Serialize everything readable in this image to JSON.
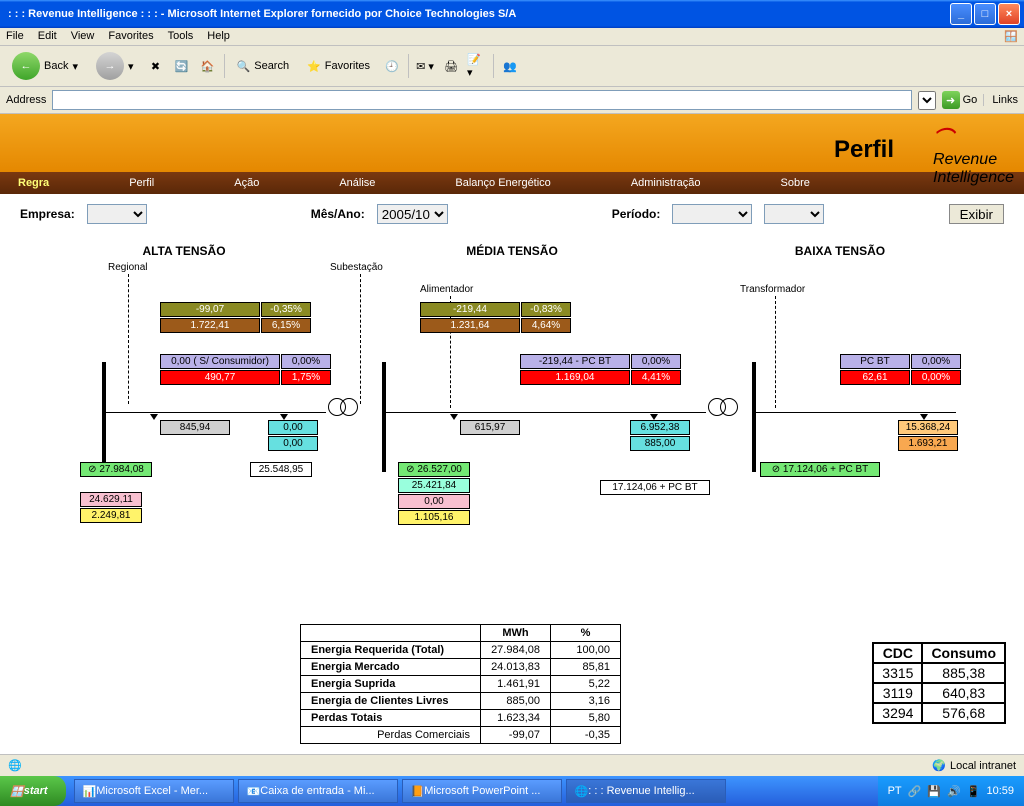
{
  "window": {
    "title": ": : : Revenue Intelligence : : : - Microsoft Internet Explorer fornecido por Choice Technologies S/A"
  },
  "menu": [
    "File",
    "Edit",
    "View",
    "Favorites",
    "Tools",
    "Help"
  ],
  "toolbar": {
    "back": "Back",
    "search": "Search",
    "favorites": "Favorites"
  },
  "addressbar": {
    "label": "Address",
    "go": "Go",
    "links": "Links"
  },
  "page": {
    "title": "Perfil",
    "brand_top": "Revenue",
    "brand_bot": "Intelligence"
  },
  "tabs": [
    "Regra",
    "Perfil",
    "Ação",
    "Análise",
    "Balanço Energético",
    "Administração",
    "Sobre"
  ],
  "filters": {
    "empresa": "Empresa:",
    "mesano": "Mês/Ano:",
    "mesano_val": "2005/10",
    "periodo": "Período:",
    "exibir": "Exibir"
  },
  "columns": [
    "ALTA TENSÃO",
    "MÉDIA TENSÃO",
    "BAIXA TENSÃO"
  ],
  "labels": {
    "regional": "Regional",
    "subestacao": "Subestação",
    "alimentador": "Alimentador",
    "transformador": "Transformador"
  },
  "alta": {
    "top_l": "-99,07",
    "top_r": "-0,35%",
    "mid_l": "1.722,41",
    "mid_r": "6,15%",
    "lav_l": "0,00 ( S/ Consumidor)",
    "lav_r": "0,00%",
    "red_l": "490,77",
    "red_r": "1,75%",
    "gray": "845,94",
    "cyan1": "0,00",
    "cyan2": "0,00",
    "green": "27.984,08",
    "white": "25.548,95",
    "pink": "24.629,11",
    "yellow": "2.249,81"
  },
  "media": {
    "top_l": "-219,44",
    "top_r": "-0,83%",
    "mid_l": "1.231,64",
    "mid_r": "4,64%",
    "lav_l": "-219,44 - PC BT",
    "lav_r": "0,00%",
    "red_l": "1.169,04",
    "red_r": "4,41%",
    "gray": "615,97",
    "cyan1": "6.952,38",
    "cyan2": "885,00",
    "green": "26.527,00",
    "aqua": "25.421,84",
    "pink": "0,00",
    "yellow": "1.105,16",
    "white": "17.124,06 + PC BT"
  },
  "baixa": {
    "lav_l": "PC BT",
    "lav_r": "0,00%",
    "red_l": "62,61",
    "red_r": "0,00%",
    "ltorange": "15.368,24",
    "orange": "1.693,21",
    "green": "17.124,06 + PC BT"
  },
  "summary": {
    "head_mwh": "MWh",
    "head_pct": "%",
    "rows": [
      {
        "label": "Energia Requerida (Total)",
        "mwh": "27.984,08",
        "pct": "100,00"
      },
      {
        "label": "Energia Mercado",
        "mwh": "24.013,83",
        "pct": "85,81"
      },
      {
        "label": "Energia Suprida",
        "mwh": "1.461,91",
        "pct": "5,22"
      },
      {
        "label": "Energia de Clientes Livres",
        "mwh": "885,00",
        "pct": "3,16"
      },
      {
        "label": "Perdas Totais",
        "mwh": "1.623,34",
        "pct": "5,80"
      },
      {
        "label": "Perdas Comerciais",
        "mwh": "-99,07",
        "pct": "-0,35"
      }
    ]
  },
  "cdc": {
    "head1": "CDC",
    "head2": "Consumo",
    "rows": [
      {
        "a": "3315",
        "b": "885,38"
      },
      {
        "a": "3119",
        "b": "640,83"
      },
      {
        "a": "3294",
        "b": "576,68"
      }
    ]
  },
  "status": {
    "zone": "Local intranet"
  },
  "taskbar": {
    "start": "start",
    "items": [
      "Microsoft Excel - Mer...",
      "Caixa de entrada - Mi...",
      "Microsoft PowerPoint ...",
      ": : : Revenue Intellig..."
    ],
    "lang": "PT",
    "clock": "10:59"
  }
}
